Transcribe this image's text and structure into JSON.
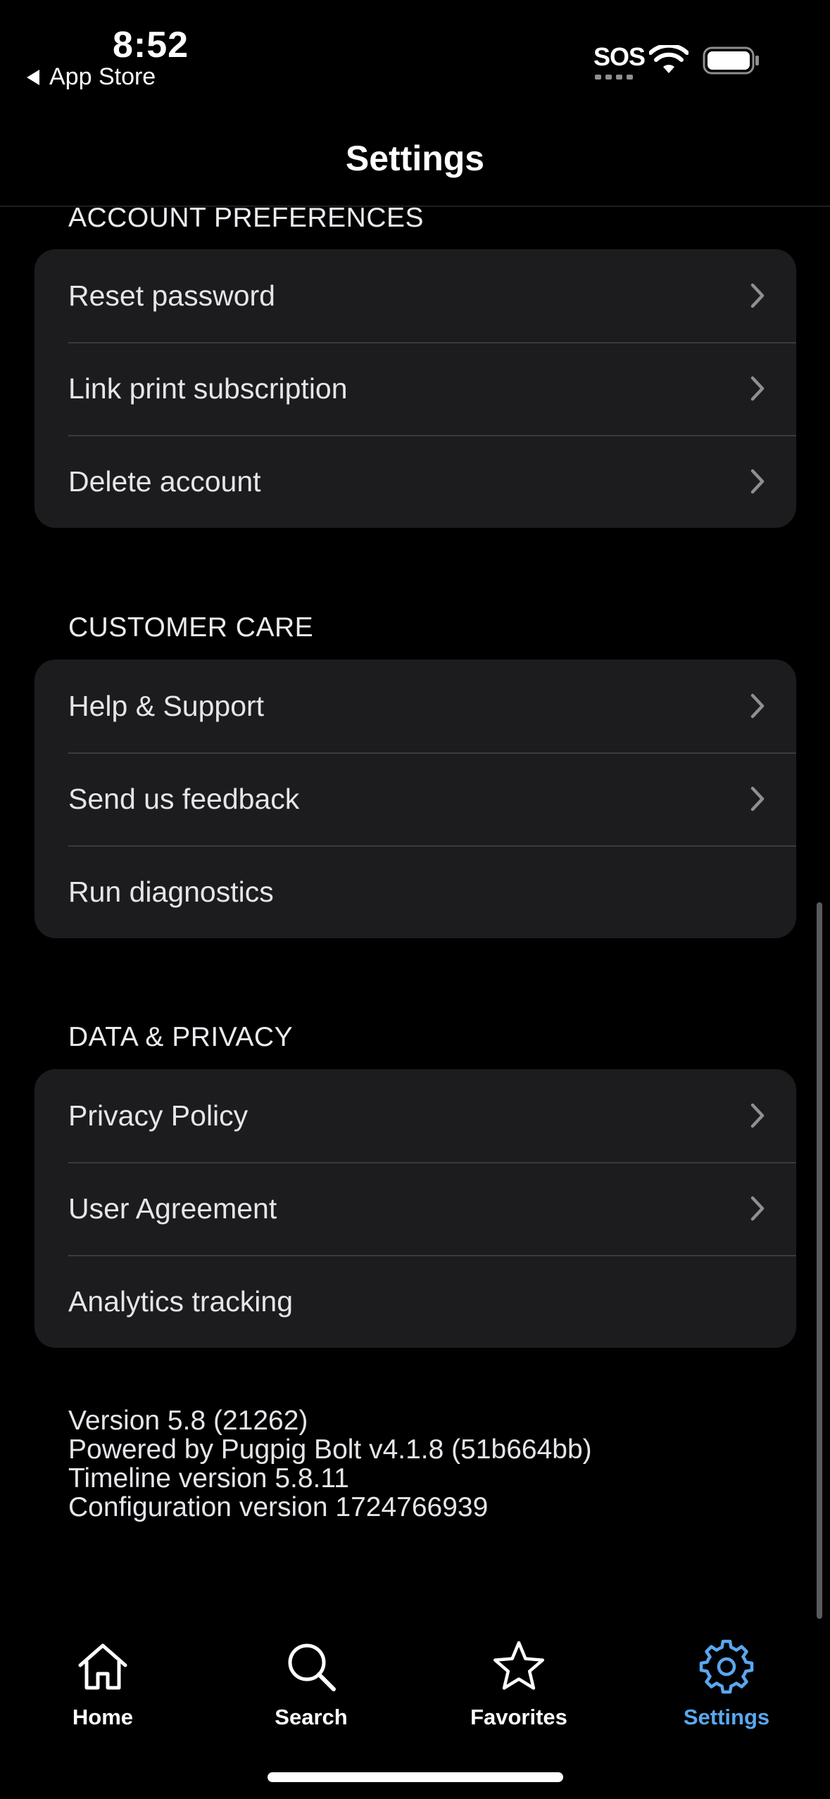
{
  "status_bar": {
    "time": "8:52",
    "back_label": "App Store",
    "carrier": "SOS"
  },
  "header": {
    "title": "Settings"
  },
  "sections": [
    {
      "title": "ACCOUNT PREFERENCES",
      "items": [
        {
          "label": "Reset password",
          "chevron": true
        },
        {
          "label": "Link print subscription",
          "chevron": true
        },
        {
          "label": "Delete account",
          "chevron": true
        }
      ]
    },
    {
      "title": "CUSTOMER CARE",
      "items": [
        {
          "label": "Help & Support",
          "chevron": true
        },
        {
          "label": "Send us feedback",
          "chevron": true
        },
        {
          "label": "Run diagnostics",
          "chevron": false
        }
      ]
    },
    {
      "title": "DATA & PRIVACY",
      "items": [
        {
          "label": "Privacy Policy",
          "chevron": true
        },
        {
          "label": "User Agreement",
          "chevron": true
        },
        {
          "label": "Analytics tracking",
          "chevron": false
        }
      ]
    }
  ],
  "version_info": {
    "version": "Version 5.8 (21262)",
    "powered_by": "Powered by Pugpig Bolt v4.1.8 (51b664bb)",
    "timeline": "Timeline version 5.8.11",
    "configuration": "Configuration version 1724766939"
  },
  "tab_bar": {
    "tabs": [
      {
        "label": "Home",
        "icon": "home-icon",
        "active": false
      },
      {
        "label": "Search",
        "icon": "search-icon",
        "active": false
      },
      {
        "label": "Favorites",
        "icon": "star-icon",
        "active": false
      },
      {
        "label": "Settings",
        "icon": "gear-icon",
        "active": true
      }
    ]
  },
  "colors": {
    "background": "#000000",
    "group_background": "#1c1c1e",
    "separator": "#3a3a3c",
    "accent": "#5aa8f0",
    "chevron": "#8e8e93"
  }
}
